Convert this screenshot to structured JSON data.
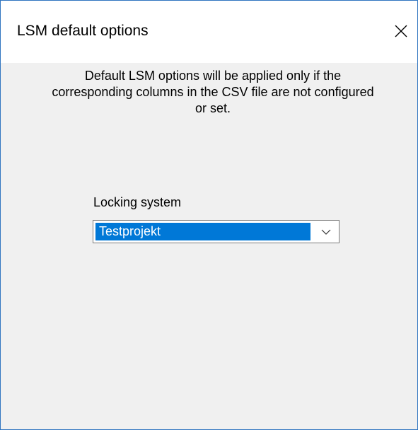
{
  "window": {
    "title": "LSM default options"
  },
  "message": {
    "text": "Default LSM options will be applied only if the corresponding columns in the CSV file are not configured or set."
  },
  "locking_system": {
    "label": "Locking system",
    "selected_value": "Testprojekt"
  },
  "icons": {
    "close": "close-icon",
    "dropdown": "chevron-down-icon"
  },
  "colors": {
    "accent": "#0078d7",
    "window_border": "#2f74c0",
    "dialog_background": "#f0f0f0"
  }
}
